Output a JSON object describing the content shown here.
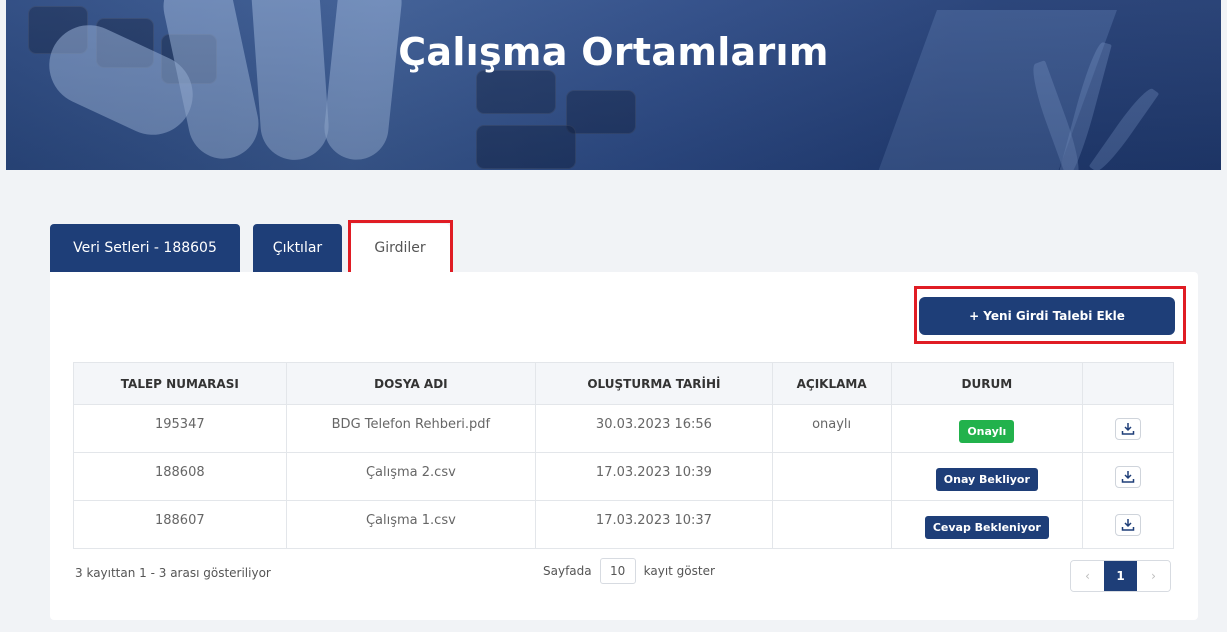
{
  "page": {
    "title": "Çalışma Ortamlarım"
  },
  "tabs": [
    {
      "label": "Veri Setleri - 188605"
    },
    {
      "label": "Çıktılar"
    },
    {
      "label": "Girdiler"
    }
  ],
  "actions": {
    "add_label": "+ Yeni Girdi Talebi Ekle"
  },
  "table": {
    "headers": [
      "TALEP NUMARASI",
      "DOSYA ADI",
      "OLUŞTURMA TARİHİ",
      "AÇIKLAMA",
      "DURUM",
      ""
    ],
    "rows": [
      {
        "talep": "195347",
        "dosya": "BDG Telefon Rehberi.pdf",
        "tarih": "30.03.2023 16:56",
        "aciklama": "onaylı",
        "durum": "Onaylı",
        "durum_color": "#22b24c"
      },
      {
        "talep": "188608",
        "dosya": "Çalışma 2.csv",
        "tarih": "17.03.2023 10:39",
        "aciklama": "",
        "durum": "Onay Bekliyor",
        "durum_color": "#1e3e78"
      },
      {
        "talep": "188607",
        "dosya": "Çalışma 1.csv",
        "tarih": "17.03.2023 10:37",
        "aciklama": "",
        "durum": "Cevap Bekleniyor",
        "durum_color": "#1e3e78"
      }
    ]
  },
  "footer": {
    "info": "3 kayıttan 1 - 3 arası gösteriliyor",
    "per_page_prefix": "Sayfada",
    "per_page_value": "10",
    "per_page_suffix": "kayıt göster",
    "prev": "‹",
    "current_page": "1",
    "next": "›"
  },
  "colors": {
    "primary": "#1e3e78",
    "success": "#22b24c",
    "highlight": "#e01c24"
  }
}
